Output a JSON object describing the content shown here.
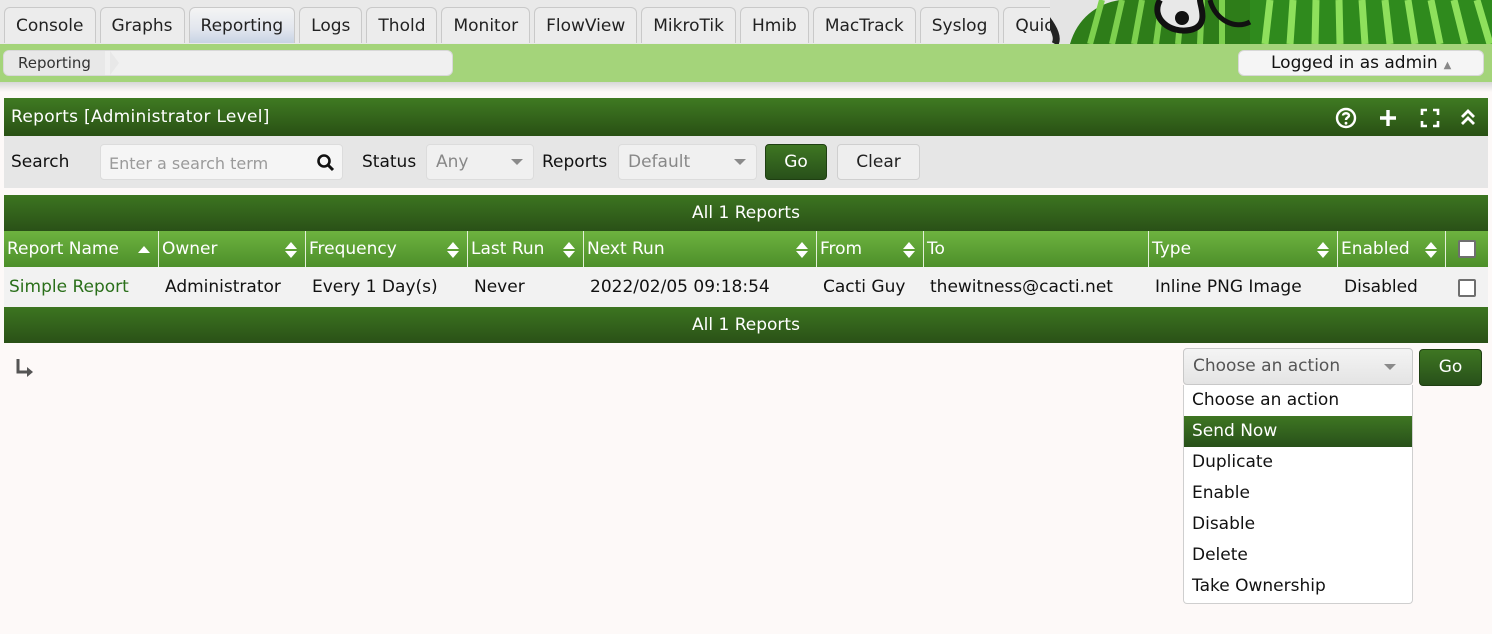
{
  "tabs": [
    "Console",
    "Graphs",
    "Reporting",
    "Logs",
    "Thold",
    "Monitor",
    "FlowView",
    "MikroTik",
    "Hmib",
    "MacTrack",
    "Syslog",
    "Quicktree"
  ],
  "selected_tab": "Reporting",
  "breadcrumb": "Reporting",
  "login_text": "Logged in as admin",
  "panel": {
    "title": "Reports [Administrator Level]"
  },
  "header_icons": [
    "help-icon",
    "add-icon",
    "fullscreen-icon",
    "collapse-icon"
  ],
  "filters": {
    "search_label": "Search",
    "search_placeholder": "Enter a search term",
    "status_label": "Status",
    "status_value": "Any",
    "reports_label": "Reports",
    "reports_value": "Default",
    "go_label": "Go",
    "clear_label": "Clear"
  },
  "table": {
    "nav_text": "All 1 Reports",
    "columns": [
      "Report Name",
      "Owner",
      "Frequency",
      "Last Run",
      "Next Run",
      "From",
      "To",
      "Type",
      "Enabled"
    ],
    "rows": [
      {
        "name": "Simple Report",
        "owner": "Administrator",
        "frequency": "Every 1 Day(s)",
        "last_run": "Never",
        "next_run": "2022/02/05 09:18:54",
        "from": "Cacti Guy",
        "to": "thewitness@cacti.net",
        "type": "Inline PNG Image",
        "enabled": "Disabled"
      }
    ]
  },
  "actions": {
    "placeholder": "Choose an action",
    "options": [
      "Choose an action",
      "Send Now",
      "Duplicate",
      "Enable",
      "Disable",
      "Delete",
      "Take Ownership"
    ],
    "highlighted": "Send Now",
    "go_label": "Go"
  },
  "colors": {
    "brand_green": "#2f5f1a",
    "header_green": "#5aa032",
    "nav_green": "#a4d47a"
  }
}
